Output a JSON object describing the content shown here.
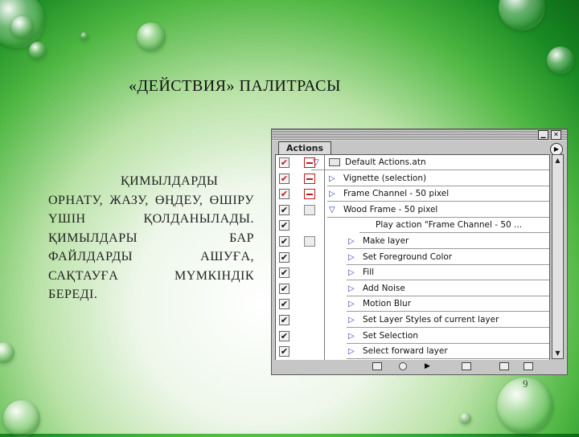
{
  "slide": {
    "title": "«ДЕЙСТВИЯ» ПАЛИТРАСЫ",
    "body": "ҚИМЫЛДАРДЫ ОРНАТУ, ЖАЗУ, ӨҢДЕУ, ӨШІРУ ҮШІН ҚОЛДАНЫЛАДЫ. ҚИМЫЛДАРЫ БАР ФАЙЛДАРДЫ АШУҒА, САҚТАУҒА МҮМКІНДІК БЕРЕДІ.",
    "page_number": "9"
  },
  "palette": {
    "tab_label": "Actions",
    "check_mark": "✔",
    "rows": [
      {
        "label": "Default Actions.atn",
        "kind": "set",
        "checked": true,
        "dialog": true,
        "expanded": true
      },
      {
        "label": "Vignette (selection)",
        "kind": "action",
        "checked": true,
        "dialog": true,
        "expanded": false
      },
      {
        "label": "Frame Channel - 50 pixel",
        "kind": "action",
        "checked": true,
        "dialog": true,
        "expanded": false
      },
      {
        "label": "Wood Frame - 50 pixel",
        "kind": "action",
        "checked": true,
        "dialog": false,
        "expanded": true
      },
      {
        "label": "Play action \"Frame Channel - 50 ...",
        "kind": "command",
        "checked": true,
        "dialog": false
      },
      {
        "label": "Make layer",
        "kind": "step",
        "checked": true,
        "dialog": false
      },
      {
        "label": "Set Foreground Color",
        "kind": "step",
        "checked": true,
        "dialog": false
      },
      {
        "label": "Fill",
        "kind": "step",
        "checked": true,
        "dialog": false
      },
      {
        "label": "Add Noise",
        "kind": "step",
        "checked": true,
        "dialog": false
      },
      {
        "label": "Motion Blur",
        "kind": "step",
        "checked": true,
        "dialog": false
      },
      {
        "label": "Set Layer Styles of current layer",
        "kind": "step",
        "checked": true,
        "dialog": false
      },
      {
        "label": "Set Selection",
        "kind": "step",
        "checked": true,
        "dialog": false
      },
      {
        "label": "Select forward layer",
        "kind": "step",
        "checked": true,
        "dialog": false
      }
    ],
    "bottom_icons": [
      "stop-icon",
      "record-icon",
      "play-icon",
      "new-set-icon",
      "new-action-icon",
      "delete-icon"
    ]
  }
}
